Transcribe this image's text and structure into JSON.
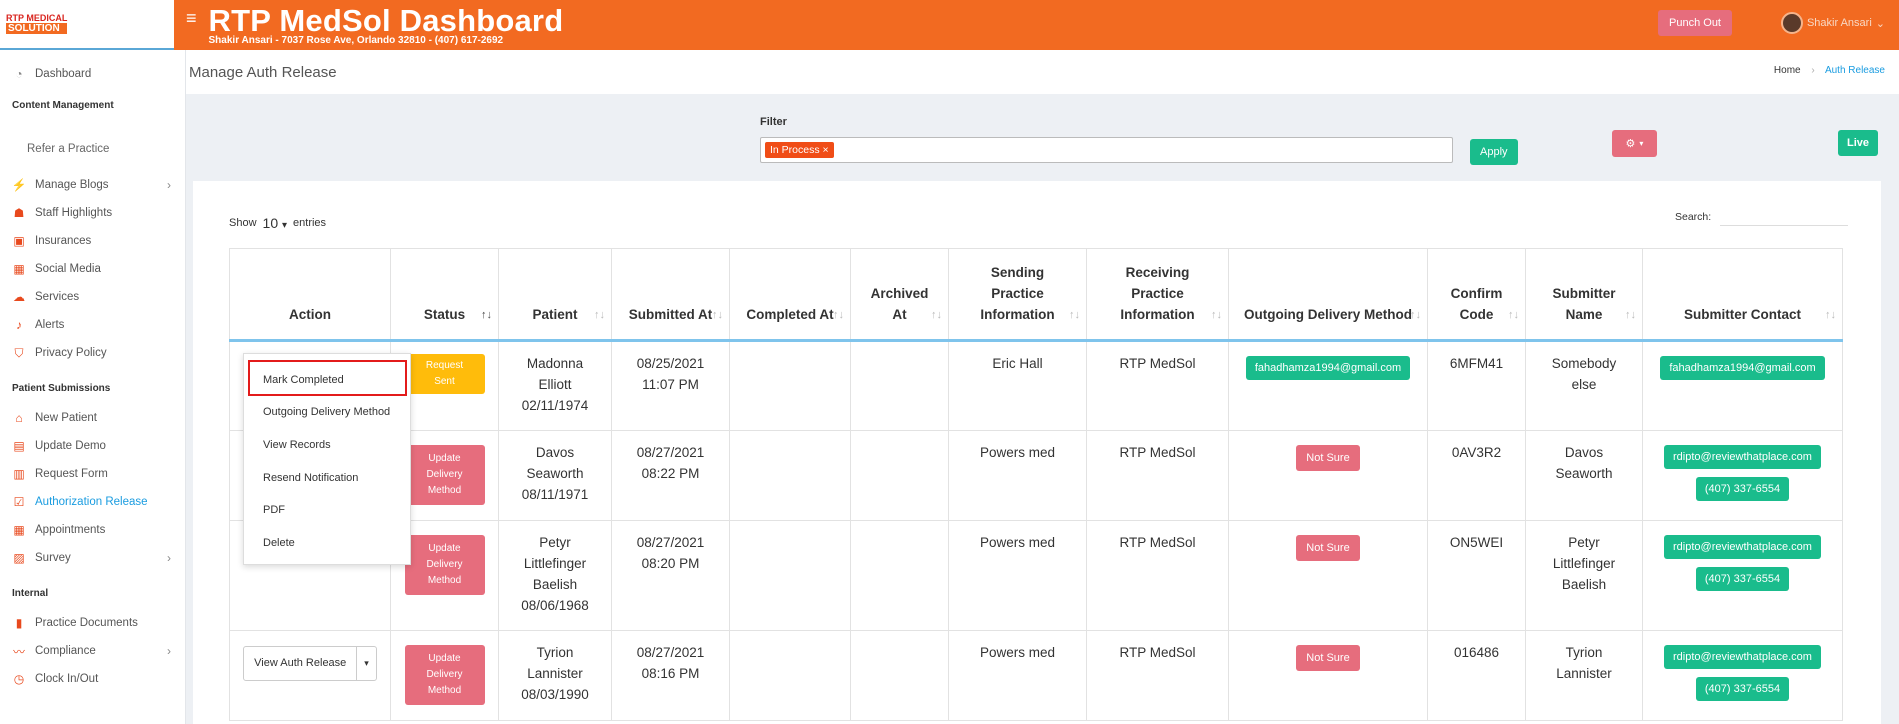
{
  "logo": {
    "line1": "RTP MEDICAL",
    "line2": "SOLUTION"
  },
  "header": {
    "title": "RTP MedSol Dashboard",
    "subtitle": "Shakir Ansari - 7037 Rose Ave, Orlando 32810 - (407) 617-2692",
    "punch_out": "Punch Out",
    "user_name": "Shakir Ansari"
  },
  "sidebar": {
    "dashboard": "Dashboard",
    "section1": "Content Management",
    "refer": "Refer a Practice",
    "items1": [
      {
        "label": "Manage Blogs",
        "icon": "blog-icon",
        "chev": true
      },
      {
        "label": "Staff Highlights",
        "icon": "staff-icon"
      },
      {
        "label": "Insurances",
        "icon": "insurance-icon"
      },
      {
        "label": "Social Media",
        "icon": "social-icon"
      },
      {
        "label": "Services",
        "icon": "services-icon"
      },
      {
        "label": "Alerts",
        "icon": "alert-icon"
      },
      {
        "label": "Privacy Policy",
        "icon": "shield-icon"
      }
    ],
    "section2": "Patient Submissions",
    "items2": [
      {
        "label": "New Patient",
        "icon": "home-icon"
      },
      {
        "label": "Update Demo",
        "icon": "id-card-icon"
      },
      {
        "label": "Request Form",
        "icon": "form-icon"
      },
      {
        "label": "Authorization Release",
        "icon": "check-doc-icon",
        "active": true
      },
      {
        "label": "Appointments",
        "icon": "calendar-icon"
      },
      {
        "label": "Survey",
        "icon": "survey-icon",
        "chev": true
      }
    ],
    "section3": "Internal",
    "items3": [
      {
        "label": "Practice Documents",
        "icon": "document-icon"
      },
      {
        "label": "Compliance",
        "icon": "compliance-icon",
        "chev": true
      },
      {
        "label": "Clock In/Out",
        "icon": "clock-icon"
      }
    ]
  },
  "page": {
    "title": "Manage Auth Release",
    "breadcrumb_home": "Home",
    "breadcrumb_current": "Auth Release"
  },
  "filter": {
    "label": "Filter",
    "chip": "In Process ×",
    "apply": "Apply",
    "live": "Live"
  },
  "table_controls": {
    "show": "Show",
    "entries_value": "10",
    "entries": "entries",
    "search": "Search:"
  },
  "columns": [
    "Action",
    "Status",
    "Patient",
    "Submitted At",
    "Completed At",
    "Archived At",
    "Sending Practice Information",
    "Receiving Practice Information",
    "Outgoing Delivery Method",
    "Confirm Code",
    "Submitter Name",
    "Submitter Contact"
  ],
  "rows": [
    {
      "status": "Request Sent",
      "status_type": "yellow",
      "patient": "Madonna Elliott 02/11/1974",
      "submitted": "08/25/2021 11:07 PM",
      "sending": "Eric Hall",
      "receiving": "RTP MedSol",
      "delivery": "fahadhamza1994@gmail.com",
      "delivery_type": "green",
      "code": "6MFM41",
      "submitter": "Somebody else",
      "email": "fahadhamza1994@gmail.com",
      "phone": ""
    },
    {
      "status": "Update Delivery Method",
      "status_type": "red",
      "patient": "Davos Seaworth 08/11/1971",
      "submitted": "08/27/2021 08:22 PM",
      "sending": "Powers med",
      "receiving": "RTP MedSol",
      "delivery": "Not Sure",
      "delivery_type": "red",
      "code": "0AV3R2",
      "submitter": "Davos Seaworth",
      "email": "rdipto@reviewthatplace.com",
      "phone": "(407) 337-6554"
    },
    {
      "status": "Update Delivery Method",
      "status_type": "red",
      "patient": "Petyr Littlefinger Baelish 08/06/1968",
      "submitted": "08/27/2021 08:20 PM",
      "sending": "Powers med",
      "receiving": "RTP MedSol",
      "delivery": "Not Sure",
      "delivery_type": "red",
      "code": "ON5WEI",
      "submitter": "Petyr Littlefinger Baelish",
      "email": "rdipto@reviewthatplace.com",
      "phone": "(407) 337-6554"
    },
    {
      "status": "Update Delivery Method",
      "status_type": "red",
      "patient": "Tyrion Lannister 08/03/1990",
      "submitted": "08/27/2021 08:16 PM",
      "sending": "Powers med",
      "receiving": "RTP MedSol",
      "delivery": "Not Sure",
      "delivery_type": "red",
      "code": "016486",
      "submitter": "Tyrion Lannister",
      "email": "rdipto@reviewthatplace.com",
      "phone": "(407) 337-6554"
    }
  ],
  "row_action": "View Auth Release",
  "dropdown": [
    "Mark Completed",
    "Outgoing Delivery Method",
    "View Records",
    "Resend Notification",
    "PDF",
    "Delete"
  ]
}
